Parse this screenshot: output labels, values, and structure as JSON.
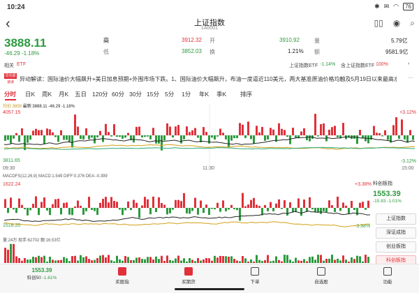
{
  "status_bar": {
    "time": "10:24",
    "battery": "76"
  },
  "header": {
    "title": "上证指数",
    "code": "1A0001",
    "tag": "​"
  },
  "quote": {
    "price": "3888.11",
    "change": "-46.29",
    "change_pct": "-1.18%",
    "high_label": "高",
    "high": "3912.32",
    "open_label": "开",
    "open": "3910.92",
    "volume_label": "量",
    "volume": "5.79亿",
    "low_label": "低",
    "low": "3852.03",
    "turnover_label": "换",
    "turnover": "1.21%",
    "amount_label": "额",
    "amount": "9581.9亿"
  },
  "related": {
    "label": "相关",
    "etf": "ETF",
    "etf1_name": "上证指数ETF",
    "etf1_chg": "-1.14%",
    "etf2_name": "含上证指数ETF",
    "etf2_chg": "100%"
  },
  "news": {
    "badge_top": "同花顺",
    "badge_bottom": "速递",
    "text": "异动解读：国际油价大幅飙升+美日加息预期+外围市场下跌。1、国际油价大幅飙升，布油一度逼近110美元，两大基准原油价格均触及5月19日以来最高水..."
  },
  "tabs": [
    "分时",
    "日K",
    "周K",
    "月K",
    "五日",
    "120分",
    "60分",
    "30分",
    "15分",
    "5分",
    "1分",
    "年K",
    "季K",
    "排序"
  ],
  "main_chart": {
    "legend_avg": "均价:3859",
    "legend_last": "最新:3888.11 -46.29 -1.18%",
    "y_max": "4057.15",
    "y_min": "3811.65",
    "pct_max": "+3.12%",
    "pct_min": "-3.12%",
    "x_start": "09:30",
    "x_mid": "11:30",
    "x_end": "15:00"
  },
  "macd": {
    "legend": "MACDFS(12,26,9)  MACD:1.549  DIFF:0.376  DEA:-0.399",
    "y_max": "1622.24",
    "y_min": "1516.20",
    "pct_max": "+3.38%",
    "pct_min": "-3.38%"
  },
  "volume": {
    "legend": "量:24万  现手:62702  额:16.53亿"
  },
  "side_panel": {
    "name": "科创板指",
    "price": "1553.39",
    "change": "-15.83",
    "change_pct": "-1.01%",
    "buttons": [
      "上证指数",
      "深证成指",
      "创业板指",
      "科创板指"
    ]
  },
  "bottom_bar": {
    "ticker_price": "1553.39",
    "ticker_name": "科创50",
    "ticker_chg": "-1.61%",
    "items": [
      "买股指",
      "买期货",
      "下单",
      "自选股",
      "功能"
    ]
  },
  "colors": {
    "up": "#e0303a",
    "down": "#2c9a3f",
    "avg": "#d4a017",
    "accent": "#e0303a"
  }
}
